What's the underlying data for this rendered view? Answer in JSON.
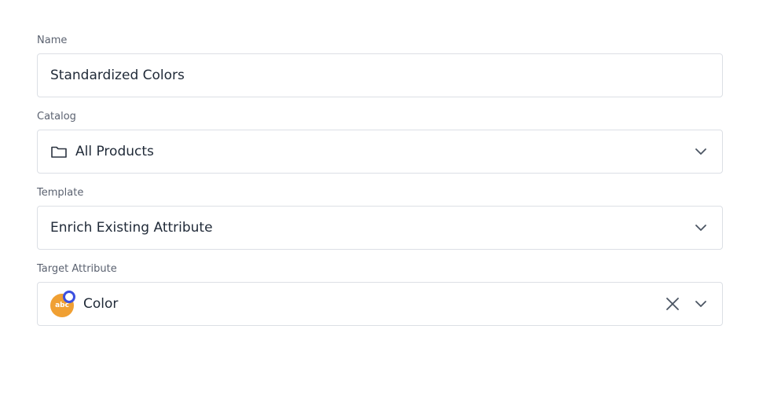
{
  "fields": {
    "name": {
      "label": "Name",
      "value": "Standardized Colors"
    },
    "catalog": {
      "label": "Catalog",
      "value": "All Products",
      "icon": "folder-icon"
    },
    "template": {
      "label": "Template",
      "value": "Enrich Existing Attribute"
    },
    "target_attribute": {
      "label": "Target Attribute",
      "value": "Color",
      "badge_text": "abc",
      "badge_color": "#f0a033",
      "badge_dot_color": "#3b4fe0"
    }
  }
}
